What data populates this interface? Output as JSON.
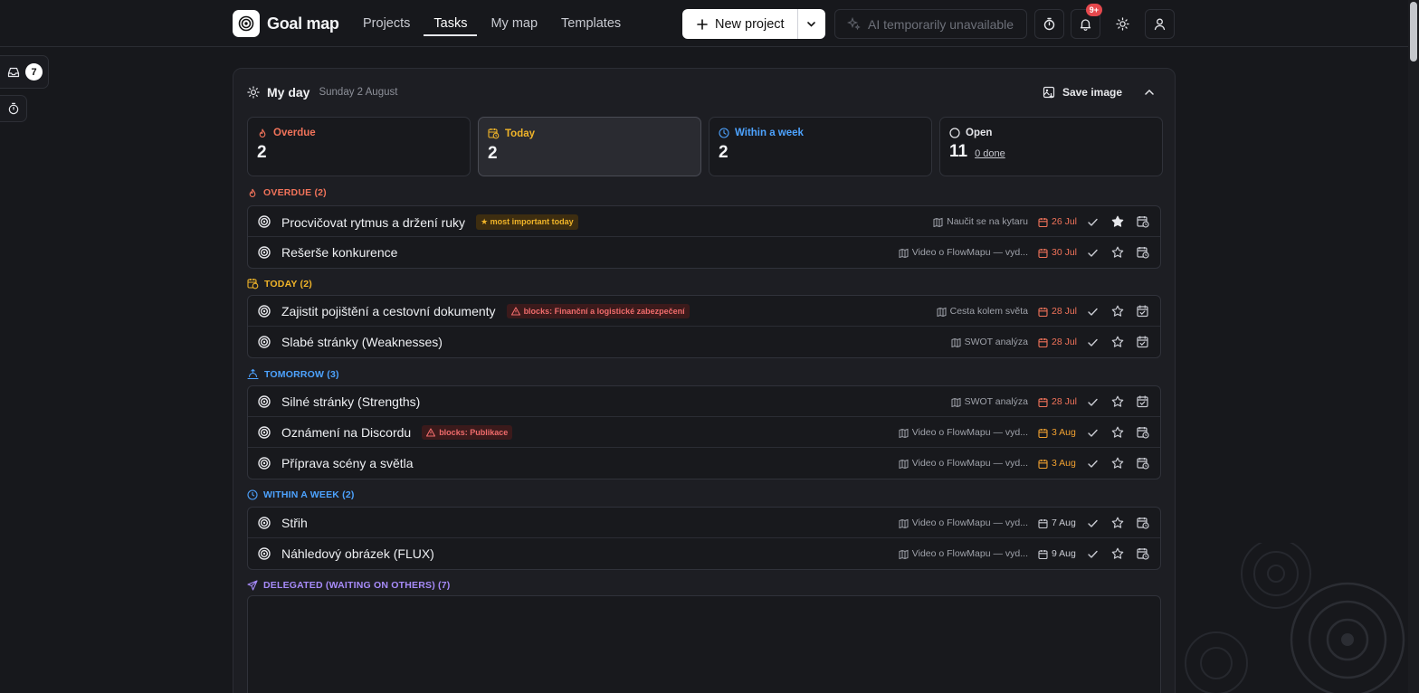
{
  "brand": {
    "name": "Goal map"
  },
  "nav": [
    {
      "label": "Projects",
      "active": false
    },
    {
      "label": "Tasks",
      "active": true
    },
    {
      "label": "My map",
      "active": false
    },
    {
      "label": "Templates",
      "active": false
    }
  ],
  "header": {
    "new_project_label": "New project",
    "ai_label": "AI temporarily unavailable",
    "notifications_badge": "9+"
  },
  "rail": {
    "inbox_count": "7"
  },
  "myday": {
    "title": "My day",
    "date": "Sunday 2 August",
    "save_image_label": "Save image"
  },
  "stats": [
    {
      "key": "overdue",
      "label": "Overdue",
      "value": "2",
      "color": "#f1735a",
      "icon": "flame-icon"
    },
    {
      "key": "today",
      "label": "Today",
      "value": "2",
      "color": "#f0b429",
      "icon": "calendar-clock-icon"
    },
    {
      "key": "week",
      "label": "Within a week",
      "value": "2",
      "color": "#4da3ff",
      "icon": "clock-icon"
    },
    {
      "key": "open",
      "label": "Open",
      "value": "11",
      "done_label": "0 done",
      "color": "#e6e7eb",
      "icon": "circle-icon"
    }
  ],
  "sections": {
    "overdue": {
      "title": "OVERDUE (2)",
      "color": "#f1735a"
    },
    "today": {
      "title": "TODAY (2)",
      "color": "#f0b429"
    },
    "tomorrow": {
      "title": "TOMORROW (3)",
      "color": "#4da3ff"
    },
    "week": {
      "title": "WITHIN A WEEK (2)",
      "color": "#4da3ff"
    },
    "delegated": {
      "title": "DELEGATED (WAITING ON OTHERS) (7)",
      "color": "#a78bfa"
    }
  },
  "groups": {
    "overdue": [
      {
        "title": "Procvičovat rytmus a držení ruky",
        "tag": "★ most important today",
        "tag_kind": "gold",
        "project": "Naučit se na kytaru",
        "due": "26 Jul",
        "due_color": "#f1735a",
        "starred": true,
        "action_icon": "calendar-clock-icon"
      },
      {
        "title": "Rešerše konkurence",
        "tag": "",
        "tag_kind": "",
        "project": "Video o FlowMapu — vyd...",
        "due": "30 Jul",
        "due_color": "#f1735a",
        "starred": false,
        "action_icon": "calendar-clock-icon"
      }
    ],
    "today": [
      {
        "title": "Zajistit pojištění a cestovní dokumenty",
        "tag": "blocks: Finanční a logistické zabezpečení",
        "tag_kind": "red",
        "project": "Cesta kolem světa",
        "due": "28 Jul",
        "due_color": "#f1735a",
        "starred": false,
        "action_icon": "calendar-check-icon"
      },
      {
        "title": "Slabé stránky (Weaknesses)",
        "tag": "",
        "tag_kind": "",
        "project": "SWOT analýza",
        "due": "28 Jul",
        "due_color": "#f1735a",
        "starred": false,
        "action_icon": "calendar-check-icon"
      }
    ],
    "tomorrow": [
      {
        "title": "Silné stránky (Strengths)",
        "tag": "",
        "tag_kind": "",
        "project": "SWOT analýza",
        "due": "28 Jul",
        "due_color": "#f1735a",
        "starred": false,
        "action_icon": "calendar-check-icon"
      },
      {
        "title": "Oznámení na Discordu",
        "tag": "blocks: Publikace",
        "tag_kind": "red",
        "project": "Video o FlowMapu — vyd...",
        "due": "3 Aug",
        "due_color": "#f0a030",
        "starred": false,
        "action_icon": "calendar-clock-icon"
      },
      {
        "title": "Příprava scény a světla",
        "tag": "",
        "tag_kind": "",
        "project": "Video o FlowMapu — vyd...",
        "due": "3 Aug",
        "due_color": "#f0a030",
        "starred": false,
        "action_icon": "calendar-clock-icon"
      }
    ],
    "week": [
      {
        "title": "Střih",
        "tag": "",
        "tag_kind": "",
        "project": "Video o FlowMapu — vyd...",
        "due": "7 Aug",
        "due_color": "#c9cbd2",
        "starred": false,
        "action_icon": "calendar-clock-icon"
      },
      {
        "title": "Náhledový obrázek (FLUX)",
        "tag": "",
        "tag_kind": "",
        "project": "Video o FlowMapu — vyd...",
        "due": "9 Aug",
        "due_color": "#c9cbd2",
        "starred": false,
        "action_icon": "calendar-clock-icon"
      }
    ]
  }
}
